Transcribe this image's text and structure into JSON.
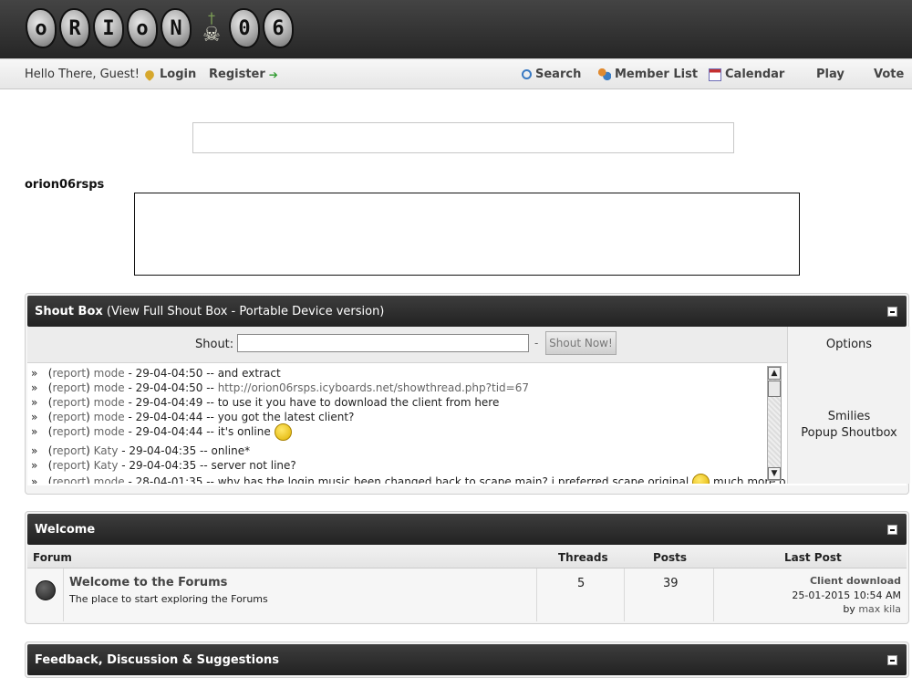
{
  "header": {
    "logo_letters": [
      "o",
      "R",
      "I",
      "o",
      "N",
      "0",
      "6"
    ],
    "logo_text": "orion 06"
  },
  "nav": {
    "greeting": "Hello There, Guest!",
    "login": "Login",
    "register": "Register",
    "search": "Search",
    "member_list": "Member List",
    "calendar": "Calendar",
    "play": "Play",
    "vote": "Vote"
  },
  "site_name": "orion06rsps",
  "shoutbox": {
    "title": "Shout Box",
    "subtitle": "(View Full Shout Box - Portable Device version)",
    "shout_label": "Shout:",
    "separator": "-",
    "shout_button": "Shout Now!",
    "options_label": "Options",
    "side_links": [
      "Smilies",
      "Popup Shoutbox"
    ],
    "messages": [
      {
        "prefix": "»",
        "report": "report",
        "user": "mode",
        "time": "29-04-04:50",
        "text": "and extract"
      },
      {
        "prefix": "»",
        "report": "report",
        "user": "mode",
        "time": "29-04-04:50",
        "text": "http://orion06rsps.icyboards.net/showthread.php?tid=67"
      },
      {
        "prefix": "»",
        "report": "report",
        "user": "mode",
        "time": "29-04-04:49",
        "text": "to use it you have to download the client from here"
      },
      {
        "prefix": "»",
        "report": "report",
        "user": "mode",
        "time": "29-04-04:44",
        "text": "you got the latest client?"
      },
      {
        "prefix": "»",
        "report": "report",
        "user": "mode",
        "time": "29-04-04:44",
        "text": "it's online"
      },
      {
        "prefix": "»",
        "report": "report",
        "user": "Katy",
        "time": "29-04-04:35",
        "text": "online*"
      },
      {
        "prefix": "»",
        "report": "report",
        "user": "Katy",
        "time": "29-04-04:35",
        "text": "server not line?"
      },
      {
        "prefix": "»",
        "report": "report",
        "user": "mode",
        "time": "28-04-01:35",
        "text": "why has the login music been changed back to scape main? i preferred scape original",
        "after": "much more old"
      }
    ]
  },
  "welcome": {
    "title": "Welcome",
    "col_forum": "Forum",
    "col_threads": "Threads",
    "col_posts": "Posts",
    "col_last": "Last Post",
    "forum": {
      "title": "Welcome to the Forums",
      "desc": "The place to start exploring the Forums",
      "threads": "5",
      "posts": "39",
      "last_title": "Client download",
      "last_date": "25-01-2015 10:54 AM",
      "last_by": "by",
      "last_user": "max kila"
    }
  },
  "feedback": {
    "title": "Feedback, Discussion & Suggestions"
  }
}
